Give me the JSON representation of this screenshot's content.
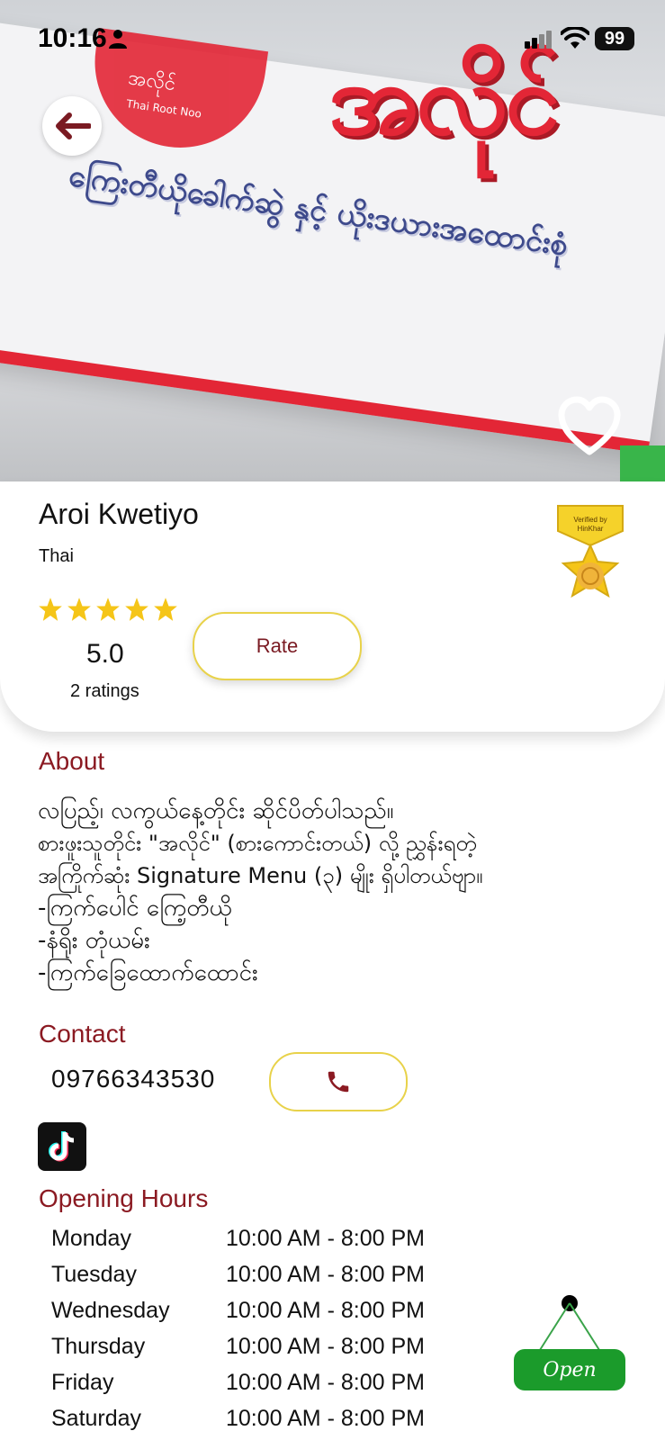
{
  "status_bar": {
    "time": "10:16",
    "battery": "99"
  },
  "hero": {
    "sign_main": "အလိုင်",
    "sign_sub": "ကြေးတီယိုခေါက်ဆွဲ နှင့် ယိုးဒယားအထောင်းစုံ",
    "bowl_text": "အလိုင်",
    "bowl_sub": "Thai Root Noo",
    "favorite_state": "not-favorited"
  },
  "restaurant": {
    "name": "Aroi Kwetiyo",
    "cuisine": "Thai",
    "rating_value": "5.0",
    "rating_count": "2 ratings",
    "stars": 5,
    "rate_label": "Rate",
    "badge_text": "Verified by HinKhar"
  },
  "about": {
    "title": "About",
    "lines": [
      "လပြည့်၊ လကွယ်နေ့တိုင်း ဆိုင်ပိတ်ပါသည်။",
      "စားဖူးသူတိုင်း \"အလိုင်\" (စားကောင်းတယ်) လို့ ညွှန်းရတဲ့",
      "အကြိုက်ဆုံး Signature Menu (၃) မျိုး ရှိပါတယ်ဗျာ။",
      "-ကြက်ပေါင် ကြေ့တီယို",
      "-နံရိုး တုံယမ်း",
      "-ကြက်ခြေထောက်ထောင်း"
    ]
  },
  "contact": {
    "title": "Contact",
    "phone": "09766343530"
  },
  "hours": {
    "title": "Opening Hours",
    "rows": [
      {
        "day": "Monday",
        "time": "10:00 AM  -  8:00 PM"
      },
      {
        "day": "Tuesday",
        "time": "10:00 AM  -  8:00 PM"
      },
      {
        "day": "Wednesday",
        "time": "10:00 AM  -  8:00 PM"
      },
      {
        "day": "Thursday",
        "time": "10:00 AM  -  8:00 PM"
      },
      {
        "day": "Friday",
        "time": "10:00 AM  -  8:00 PM"
      },
      {
        "day": "Saturday",
        "time": "10:00 AM  -  8:00 PM"
      }
    ],
    "open_sign": "Open"
  },
  "colors": {
    "accent": "#8b1a22",
    "star": "#f5c518",
    "button_border": "#e8d24a",
    "open_green": "#1b9b2b"
  }
}
